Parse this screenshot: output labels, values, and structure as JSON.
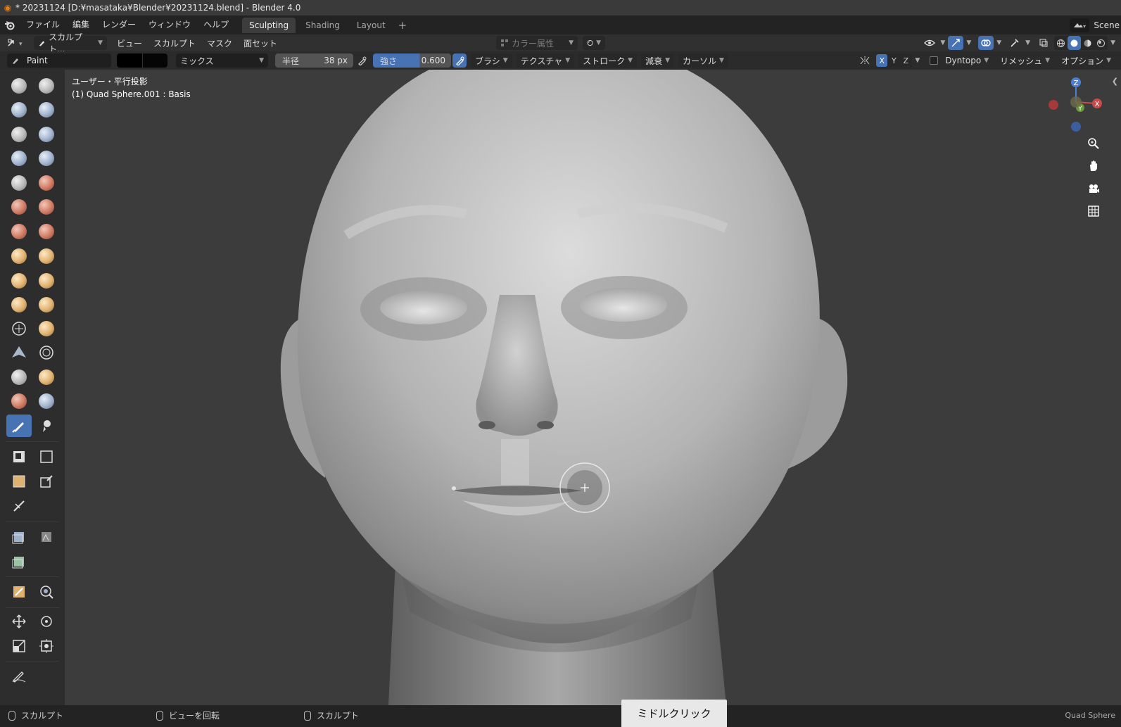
{
  "window": {
    "title": "* 20231124 [D:¥masataka¥Blender¥20231124.blend] - Blender 4.0"
  },
  "menu": {
    "items": [
      "ファイル",
      "編集",
      "レンダー",
      "ウィンドウ",
      "ヘルプ"
    ],
    "workspaces": [
      "Sculpting",
      "Shading",
      "Layout"
    ],
    "active_workspace": "Sculpting",
    "add_workspace": "+",
    "scene_label": "Scene"
  },
  "viewport_header": {
    "mode": "スカルプト...",
    "items": [
      "ビュー",
      "スカルプト",
      "マスク",
      "面セット"
    ],
    "color_attribute": "カラー属性"
  },
  "tool_settings": {
    "brush_name": "Paint",
    "blend_mode": "ミックス",
    "radius_label": "半径",
    "radius_value": "38 px",
    "strength_label": "強さ",
    "strength_value": "0.600",
    "menus": [
      "ブラシ",
      "テクスチャ",
      "ストローク",
      "減衰",
      "カーソル"
    ],
    "axes": [
      "X",
      "Y",
      "Z"
    ],
    "dyntopo": "Dyntopo",
    "remesh": "リメッシュ",
    "options": "オプション"
  },
  "viewport": {
    "view_name": "ユーザー・平行投影",
    "object_info": "(1) Quad Sphere.001 : Basis",
    "gizmo": {
      "z": "Z",
      "y": "Y",
      "x": "X"
    }
  },
  "status_bar": {
    "left_action": "スカルプト",
    "mid_action": "ビューを回転",
    "right_action": "スカルプト",
    "key_hint": "ミドルクリック",
    "object": "Quad Sphere"
  },
  "colors": {
    "accent": "#4772b3",
    "background": "#3c3c3c",
    "panel": "#2d2d2d",
    "header": "#303030"
  }
}
